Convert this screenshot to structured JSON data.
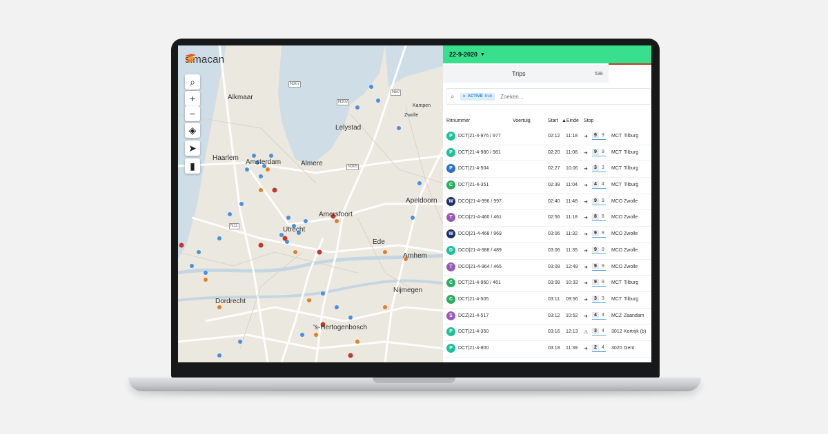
{
  "app": {
    "brand_name": "simacan"
  },
  "map": {
    "controls": [
      {
        "name": "search-icon",
        "glyph": "⌕"
      },
      {
        "name": "zoom-in-icon",
        "glyph": "+"
      },
      {
        "name": "zoom-out-icon",
        "glyph": "−"
      },
      {
        "name": "layers-icon",
        "glyph": "◈"
      },
      {
        "name": "locate-icon",
        "glyph": "➤"
      },
      {
        "name": "map-icon",
        "glyph": "▮"
      }
    ],
    "cities": [
      "Alkmaar",
      "Lelystad",
      "Haarlem",
      "Amsterdam",
      "Almere",
      "Amersfoort",
      "Apeldoorn",
      "Ede",
      "Arnhem",
      "Nijmegen",
      "Dordrecht",
      "'s-Hertogenbosch",
      "Utrecht",
      "Kampen",
      "Zwolle"
    ],
    "road_labels": [
      "N307",
      "N50",
      "N302",
      "N305",
      "N11"
    ]
  },
  "panel": {
    "date": "22-9-2020",
    "tab_title": "Trips",
    "trip_count": "538",
    "filter": {
      "remove": "×",
      "key": "ACTIVE",
      "value": "true"
    },
    "search_placeholder": "Zoeken...",
    "columns": {
      "ritnummer": "Ritnummer",
      "voertuig": "Voertuig",
      "start": "Start",
      "einde": "▲Einde",
      "stop": "Stop"
    },
    "trips": [
      {
        "badge": "P",
        "color": "#1fbf9a",
        "ritnummer": "DCT|21-4-976 / 977",
        "start": "02:12",
        "einde": "11:18",
        "arrow": "➜",
        "stop_done": "9",
        "stop_total": "9",
        "code": "MCT",
        "city": "Tilburg"
      },
      {
        "badge": "P",
        "color": "#1fbf9a",
        "ritnummer": "DCT|21-4-980 / 981",
        "start": "02:20",
        "einde": "11:08",
        "arrow": "➜",
        "stop_done": "9",
        "stop_total": "9",
        "code": "MCT",
        "city": "Tilburg"
      },
      {
        "badge": "P",
        "color": "#2e6fd0",
        "ritnummer": "DCT|21-4-504",
        "start": "02:27",
        "einde": "10:06",
        "arrow": "➜",
        "stop_done": "3",
        "stop_total": "3",
        "code": "MCT",
        "city": "Tilburg"
      },
      {
        "badge": "C",
        "color": "#27ae60",
        "ritnummer": "DCT|21-4-351",
        "start": "02:39",
        "einde": "11:04",
        "arrow": "➜",
        "stop_done": "4",
        "stop_total": "4",
        "code": "MCT",
        "city": "Tilburg"
      },
      {
        "badge": "W",
        "color": "#1b2f6e",
        "ritnummer": "DCO|21-4-996 / 997",
        "start": "02:40",
        "einde": "11:48",
        "arrow": "➜",
        "stop_done": "9",
        "stop_total": "9",
        "code": "MCO",
        "city": "Zwolle"
      },
      {
        "badge": "T",
        "color": "#9b59b6",
        "ritnummer": "DCO|21-4-460 / 461",
        "start": "02:56",
        "einde": "11:18",
        "arrow": "➜",
        "stop_done": "8",
        "stop_total": "8",
        "code": "MCO",
        "city": "Zwolle"
      },
      {
        "badge": "W",
        "color": "#1b2f6e",
        "ritnummer": "DCO|21-4-468 / 969",
        "start": "03:06",
        "einde": "11:32",
        "arrow": "➜",
        "stop_done": "9",
        "stop_total": "9",
        "code": "MCO",
        "city": "Zwolle"
      },
      {
        "badge": "D",
        "color": "#1fbf9a",
        "ritnummer": "DCO|21-4-988 / 489",
        "start": "03:06",
        "einde": "11:35",
        "arrow": "➜",
        "stop_done": "9",
        "stop_total": "9",
        "code": "MCO",
        "city": "Zwolle"
      },
      {
        "badge": "T",
        "color": "#9b59b6",
        "ritnummer": "DCO|21-4-964 / 465",
        "start": "03:08",
        "einde": "12:49",
        "arrow": "➜",
        "stop_done": "9",
        "stop_total": "9",
        "code": "MCO",
        "city": "Zwolle"
      },
      {
        "badge": "C",
        "color": "#27ae60",
        "ritnummer": "DCT|21-4-960 / 461",
        "start": "03:08",
        "einde": "10:33",
        "arrow": "➜",
        "stop_done": "9",
        "stop_total": "9",
        "code": "MCT",
        "city": "Tilburg"
      },
      {
        "badge": "C",
        "color": "#27ae60",
        "ritnummer": "DCT|21-4-505",
        "start": "03:11",
        "einde": "09:56",
        "arrow": "➜",
        "stop_done": "3",
        "stop_total": "3",
        "code": "MCT",
        "city": "Tilburg"
      },
      {
        "badge": "S",
        "color": "#9b59b6",
        "ritnummer": "DCZ|21-4-517",
        "start": "03:12",
        "einde": "10:52",
        "arrow": "➜",
        "stop_done": "4",
        "stop_total": "4",
        "code": "MCZ",
        "city": "Zaandam"
      },
      {
        "badge": "P",
        "color": "#1fbf9a",
        "ritnummer": "DCT|21-4-350",
        "start": "03:16",
        "einde": "12:13",
        "arrow": "⚠",
        "stop_done": "3",
        "stop_total": "4",
        "code": "3012",
        "city": "Kortrijk (b)"
      },
      {
        "badge": "P",
        "color": "#1fbf9a",
        "ritnummer": "DCT|21-4-800",
        "start": "03:18",
        "einde": "11:39",
        "arrow": "➜",
        "stop_done": "2",
        "stop_total": "4",
        "code": "3020",
        "city": "Gent"
      }
    ]
  }
}
